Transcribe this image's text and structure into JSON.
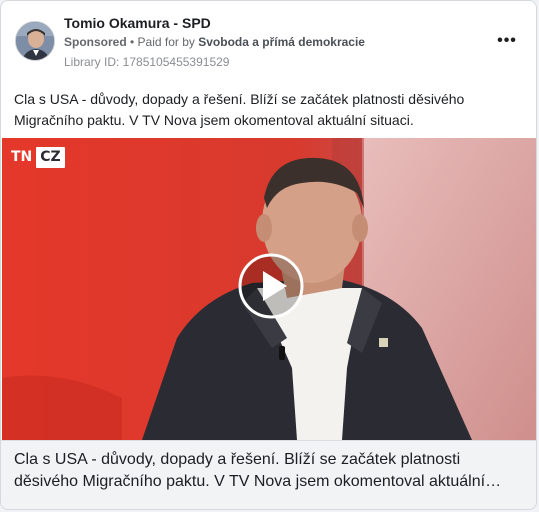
{
  "post": {
    "page_name": "Tomio Okamura - SPD",
    "sponsored": "Sponsored",
    "separator": " • ",
    "paid_for_prefix": "Paid for by ",
    "payer": "Svoboda a přímá demokracie",
    "library_id": "Library ID: 1785105455391529",
    "body": "Cla s USA - důvody, dopady a řešení. Blíží se začátek platnosti děsivého Migračního paktu. V TV Nova jsem okomentoval aktuální situaci.",
    "more_icon": "ellipsis-icon"
  },
  "video": {
    "logo_left": "TN",
    "logo_right": "CZ",
    "play_icon": "play-icon",
    "caption": "Cla s USA - důvody, dopady a řešení. Blíží se začátek platnosti děsivého Migračního paktu. V TV Nova jsem okomentoval aktuální…"
  },
  "colors": {
    "accent_red": "#d63327",
    "text": "#1c1e21",
    "secondary": "#65676b"
  }
}
